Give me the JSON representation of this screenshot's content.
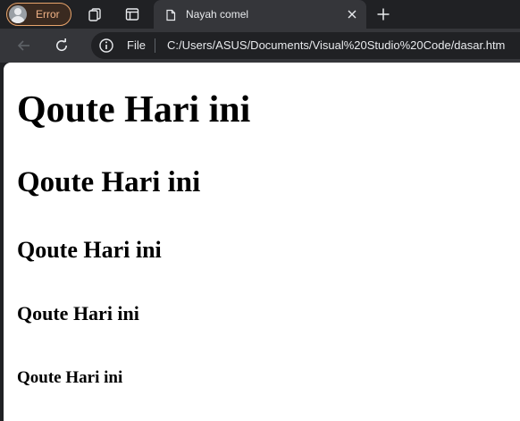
{
  "tabstrip": {
    "profile_label": "Error",
    "tab_title": "Nayah comel"
  },
  "toolbar": {
    "site_info_label": "File",
    "url": "C:/Users/ASUS/Documents/Visual%20Studio%20Code/dasar.htm"
  },
  "page": {
    "h1": "Qoute Hari ini",
    "h2": "Qoute Hari ini",
    "h3": "Qoute Hari ini",
    "h4": "Qoute Hari ini",
    "h5": "Qoute Hari ini"
  },
  "colors": {
    "profile_accent": "#f0b286",
    "chrome_dark": "#202124",
    "chrome_toolbar": "#35363a"
  },
  "icons": {
    "profile": "avatar-icon",
    "workspaces": "workspaces-icon",
    "tab_actions": "tab-actions-icon",
    "tab_favicon": "document-icon",
    "tab_close": "close-icon",
    "new_tab": "plus-icon",
    "back": "arrow-left-icon",
    "reload": "reload-icon",
    "site_info": "info-icon"
  }
}
